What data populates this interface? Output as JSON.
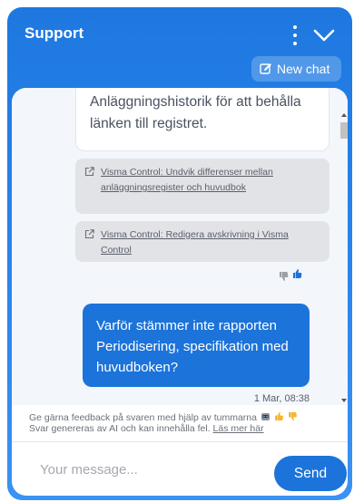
{
  "header": {
    "title": "Support",
    "new_chat_label": "New chat"
  },
  "conversation": {
    "bot_message": "Anläggningshistorik för att behålla länken till registret.",
    "links": [
      {
        "label": "Visma Control:  Undvik differenser mellan anläggningsregister och huvudbok"
      },
      {
        "label": "Visma Control:  Redigera avskrivning i Visma Control"
      }
    ],
    "user_message": "Varför stämmer inte rapporten Periodisering, specifikation med huvudboken?",
    "timestamp": "1 Mar, 08:38"
  },
  "feedback": {
    "line1": "Ge gärna feedback på svaren med hjälp av tummarna",
    "line2": "Svar genereras av AI och kan innehålla fel.",
    "read_more": "Läs mer här"
  },
  "composer": {
    "placeholder": "Your message...",
    "send_label": "Send"
  },
  "colors": {
    "header_blue": "#1e78e0",
    "accent_blue": "#1c73d9",
    "link_bg": "#e1e3e7",
    "conversation_bg": "#f3f6fb"
  }
}
